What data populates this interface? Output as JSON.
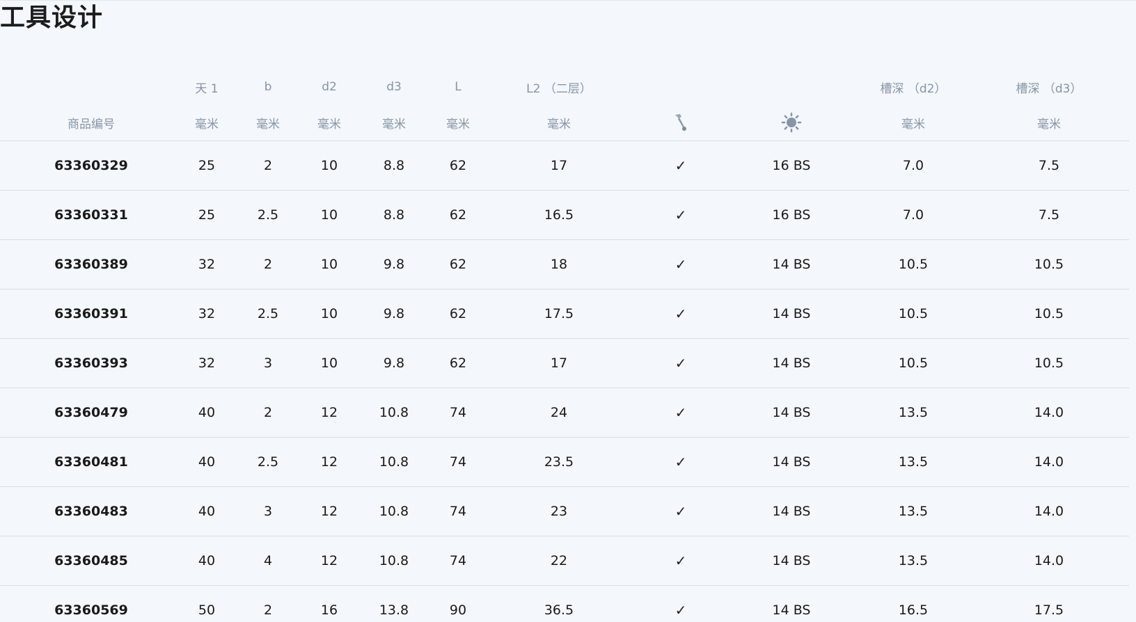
{
  "page": {
    "title": "工具设计"
  },
  "table": {
    "header_row1": [
      "",
      "天 1",
      "b",
      "d2",
      "d3",
      "L",
      "L2 （二层）",
      "",
      "",
      "槽深 （d2）",
      "槽深 （d3）"
    ],
    "header_row2": [
      "商品编号",
      "毫米",
      "毫米",
      "毫米",
      "毫米",
      "毫米",
      "毫米",
      "",
      "",
      "毫米",
      "毫米"
    ],
    "icons": {
      "col7": "tool-icon",
      "col8": "sun-icon"
    },
    "rows": [
      {
        "id": "63360329",
        "tian": "25",
        "b": "2",
        "d2": "10",
        "d3": "8.8",
        "L": "62",
        "L2": "17",
        "check": "✓",
        "gear": "16 BS",
        "gd2": "7.0",
        "gd3": "7.5"
      },
      {
        "id": "63360331",
        "tian": "25",
        "b": "2.5",
        "d2": "10",
        "d3": "8.8",
        "L": "62",
        "L2": "16.5",
        "check": "✓",
        "gear": "16 BS",
        "gd2": "7.0",
        "gd3": "7.5"
      },
      {
        "id": "63360389",
        "tian": "32",
        "b": "2",
        "d2": "10",
        "d3": "9.8",
        "L": "62",
        "L2": "18",
        "check": "✓",
        "gear": "14 BS",
        "gd2": "10.5",
        "gd3": "10.5"
      },
      {
        "id": "63360391",
        "tian": "32",
        "b": "2.5",
        "d2": "10",
        "d3": "9.8",
        "L": "62",
        "L2": "17.5",
        "check": "✓",
        "gear": "14 BS",
        "gd2": "10.5",
        "gd3": "10.5"
      },
      {
        "id": "63360393",
        "tian": "32",
        "b": "3",
        "d2": "10",
        "d3": "9.8",
        "L": "62",
        "L2": "17",
        "check": "✓",
        "gear": "14 BS",
        "gd2": "10.5",
        "gd3": "10.5"
      },
      {
        "id": "63360479",
        "tian": "40",
        "b": "2",
        "d2": "12",
        "d3": "10.8",
        "L": "74",
        "L2": "24",
        "check": "✓",
        "gear": "14 BS",
        "gd2": "13.5",
        "gd3": "14.0"
      },
      {
        "id": "63360481",
        "tian": "40",
        "b": "2.5",
        "d2": "12",
        "d3": "10.8",
        "L": "74",
        "L2": "23.5",
        "check": "✓",
        "gear": "14 BS",
        "gd2": "13.5",
        "gd3": "14.0"
      },
      {
        "id": "63360483",
        "tian": "40",
        "b": "3",
        "d2": "12",
        "d3": "10.8",
        "L": "74",
        "L2": "23",
        "check": "✓",
        "gear": "14 BS",
        "gd2": "13.5",
        "gd3": "14.0"
      },
      {
        "id": "63360485",
        "tian": "40",
        "b": "4",
        "d2": "12",
        "d3": "10.8",
        "L": "74",
        "L2": "22",
        "check": "✓",
        "gear": "14 BS",
        "gd2": "13.5",
        "gd3": "14.0"
      },
      {
        "id": "63360569",
        "tian": "50",
        "b": "2",
        "d2": "16",
        "d3": "13.8",
        "L": "90",
        "L2": "36.5",
        "check": "✓",
        "gear": "14 BS",
        "gd2": "16.5",
        "gd3": "17.5"
      }
    ]
  }
}
